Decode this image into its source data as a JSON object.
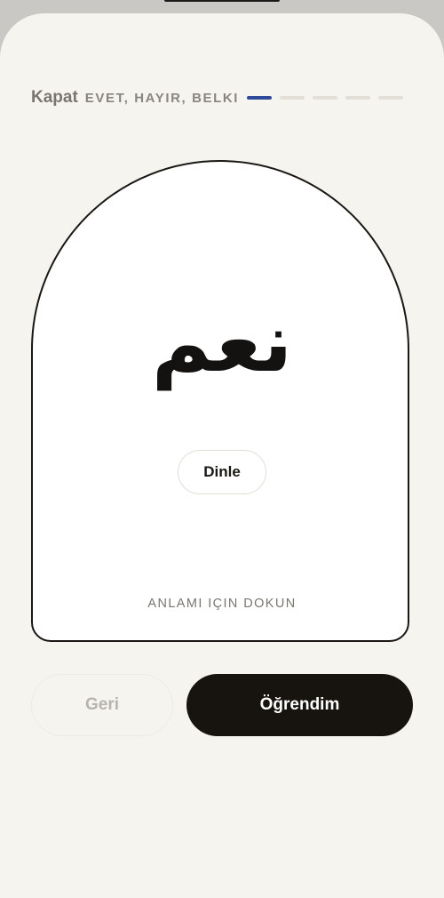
{
  "header": {
    "close_label": "Kapat",
    "deck_title": "EVET, HAYIR, BELKI"
  },
  "progress": {
    "current": 1,
    "total": 5
  },
  "card": {
    "word": "نعم",
    "listen_label": "Dinle",
    "hint": "ANLAMI IÇIN DOKUN"
  },
  "actions": {
    "back_label": "Geri",
    "learned_label": "Öğrendim"
  },
  "colors": {
    "background": "#f6f4ef",
    "accent": "#2e4a9a",
    "primary_button": "#17140f"
  }
}
